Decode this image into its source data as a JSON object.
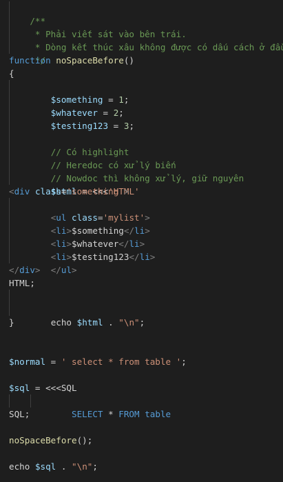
{
  "colors": {
    "background": "#1e1e1e",
    "comment": "#6a9955",
    "keyword": "#569cd6",
    "function": "#dcdcaa",
    "variable": "#9cdcfe",
    "number": "#b5cea8",
    "string": "#ce9178",
    "tag_bracket": "#808080",
    "plain": "#d4d4d4"
  },
  "code": {
    "l1": {
      "t1": "/**"
    },
    "l2": {
      "t1": " * Phải viết sát vào bên trái."
    },
    "l3": {
      "t1": " * Dòng kết thúc xâu không được có dấu cách ở đầu."
    },
    "l4": {
      "t1": " */"
    },
    "l5": {
      "t1": "function",
      "t2": " ",
      "t3": "noSpaceBefore",
      "t4": "()"
    },
    "l6": {
      "t1": "{"
    },
    "l7": {
      "t1": "    ",
      "t2": "$something",
      "t3": " = ",
      "t4": "1",
      "t5": ";"
    },
    "l8": {
      "t1": "    ",
      "t2": "$whatever",
      "t3": " = ",
      "t4": "2",
      "t5": ";"
    },
    "l9": {
      "t1": "    ",
      "t2": "$testing123",
      "t3": " = ",
      "t4": "3",
      "t5": ";"
    },
    "l10": {
      "t1": ""
    },
    "l11": {
      "t1": "    ",
      "t2": "// Có highlight"
    },
    "l12": {
      "t1": "    ",
      "t2": "// Heredoc có xử lý biến"
    },
    "l13": {
      "t1": "    ",
      "t2": "// Nowdoc thì không xử lý, giữ nguyên"
    },
    "l14": {
      "t1": "    ",
      "t2": "$html",
      "t3": " = ",
      "t4": "<<<",
      "t5": "'HTML'"
    },
    "l15": {
      "t1": "<",
      "t2": "div",
      "t3": " ",
      "t4": "class",
      "t5": "=",
      "t6": "'something'",
      "t7": ">"
    },
    "l16": {
      "t1": "    ",
      "t2": "<",
      "t3": "ul",
      "t4": " ",
      "t5": "class",
      "t6": "=",
      "t7": "'mylist'",
      "t8": ">"
    },
    "l17": {
      "t1": "    ",
      "t2": "<",
      "t3": "li",
      "t4": ">",
      "t5": "$something",
      "t6": "</",
      "t7": "li",
      "t8": ">"
    },
    "l18": {
      "t1": "    ",
      "t2": "<",
      "t3": "li",
      "t4": ">",
      "t5": "$whatever",
      "t6": "</",
      "t7": "li",
      "t8": ">"
    },
    "l19": {
      "t1": "    ",
      "t2": "<",
      "t3": "li",
      "t4": ">",
      "t5": "$testing123",
      "t6": "</",
      "t7": "li",
      "t8": ">"
    },
    "l20": {
      "t1": "    ",
      "t2": "</",
      "t3": "ul",
      "t4": ">"
    },
    "l21": {
      "t1": "</",
      "t2": "div",
      "t3": ">"
    },
    "l22": {
      "t1": "HTML;"
    },
    "l23": {
      "t1": ""
    },
    "l24": {
      "t1": "    ",
      "t2": "echo",
      "t3": " ",
      "t4": "$html",
      "t5": " . ",
      "t6": "\"\\n\"",
      "t7": ";"
    },
    "l25": {
      "t1": "}"
    },
    "l26": {
      "t1": ""
    },
    "l27": {
      "t1": ""
    },
    "l28": {
      "t1": "$normal",
      "t2": " = ",
      "t3": "' select * from table '",
      "t4": ";"
    },
    "l29": {
      "t1": ""
    },
    "l30": {
      "t1": "$sql",
      "t2": " = ",
      "t3": "<<<",
      "t4": "SQL"
    },
    "l31": {
      "t1": "        ",
      "t2": "SELECT",
      "t3": " * ",
      "t4": "FROM",
      "t5": " ",
      "t6": "table"
    },
    "l32": {
      "t1": "SQL;"
    },
    "l33": {
      "t1": ""
    },
    "l34": {
      "t1": "noSpaceBefore",
      "t2": "();"
    },
    "l35": {
      "t1": ""
    },
    "l36": {
      "t1": "echo",
      "t2": " ",
      "t3": "$sql",
      "t4": " . ",
      "t5": "\"\\n\"",
      "t6": ";"
    }
  }
}
